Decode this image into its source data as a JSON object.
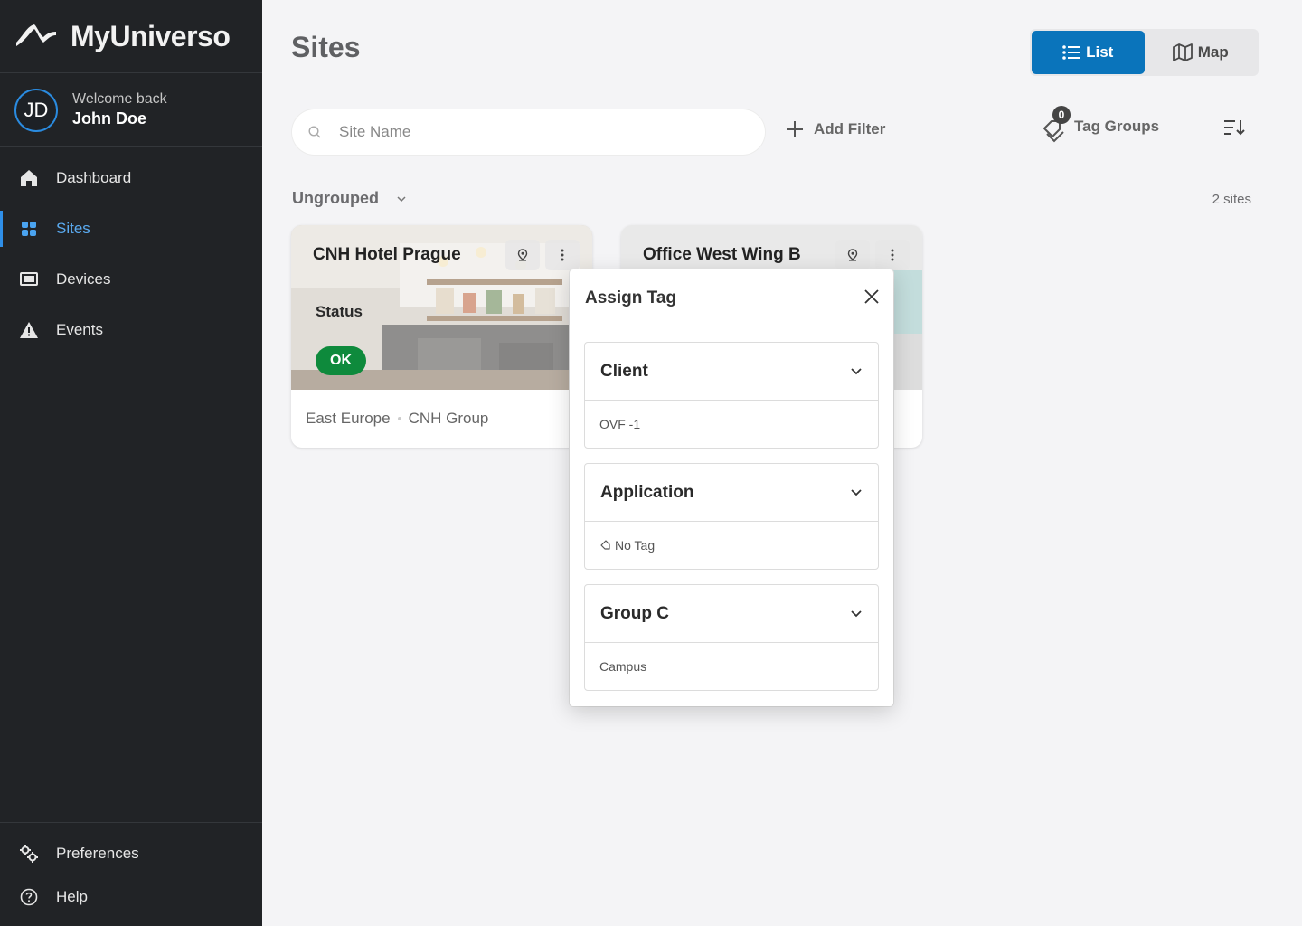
{
  "app": {
    "name": "MyUniverso"
  },
  "user": {
    "initials": "JD",
    "welcome": "Welcome back",
    "name": "John Doe"
  },
  "nav": {
    "items": [
      {
        "label": "Dashboard",
        "icon": "home-icon"
      },
      {
        "label": "Sites",
        "icon": "grid-icon",
        "active": true
      },
      {
        "label": "Devices",
        "icon": "device-icon"
      },
      {
        "label": "Events",
        "icon": "warning-icon"
      }
    ],
    "bottom": [
      {
        "label": "Preferences",
        "icon": "gears-icon"
      },
      {
        "label": "Help",
        "icon": "help-icon"
      }
    ]
  },
  "page": {
    "title": "Sites"
  },
  "view_toggle": {
    "list_label": "List",
    "map_label": "Map",
    "selected": "List"
  },
  "search": {
    "placeholder": "Site Name",
    "value": ""
  },
  "add_filter_label": "Add Filter",
  "tag_groups": {
    "label": "Tag Groups",
    "count": "0"
  },
  "group": {
    "label": "Ungrouped",
    "count_label": "2 sites"
  },
  "sites": [
    {
      "name": "CNH Hotel Prague",
      "status_label": "Status",
      "status": "OK",
      "region": "East Europe",
      "group": "CNH Group"
    },
    {
      "name": "Office West Wing B"
    }
  ],
  "assign_tag": {
    "title": "Assign Tag",
    "sections": [
      {
        "name": "Client",
        "value": "OVF -1"
      },
      {
        "name": "Application",
        "value": "No Tag"
      },
      {
        "name": "Group C",
        "value": "Campus"
      }
    ]
  },
  "colors": {
    "accent": "#0a74bb",
    "sidebar": "#212326",
    "status_ok": "#0e8a3c",
    "active_nav": "#5aaaf0"
  }
}
